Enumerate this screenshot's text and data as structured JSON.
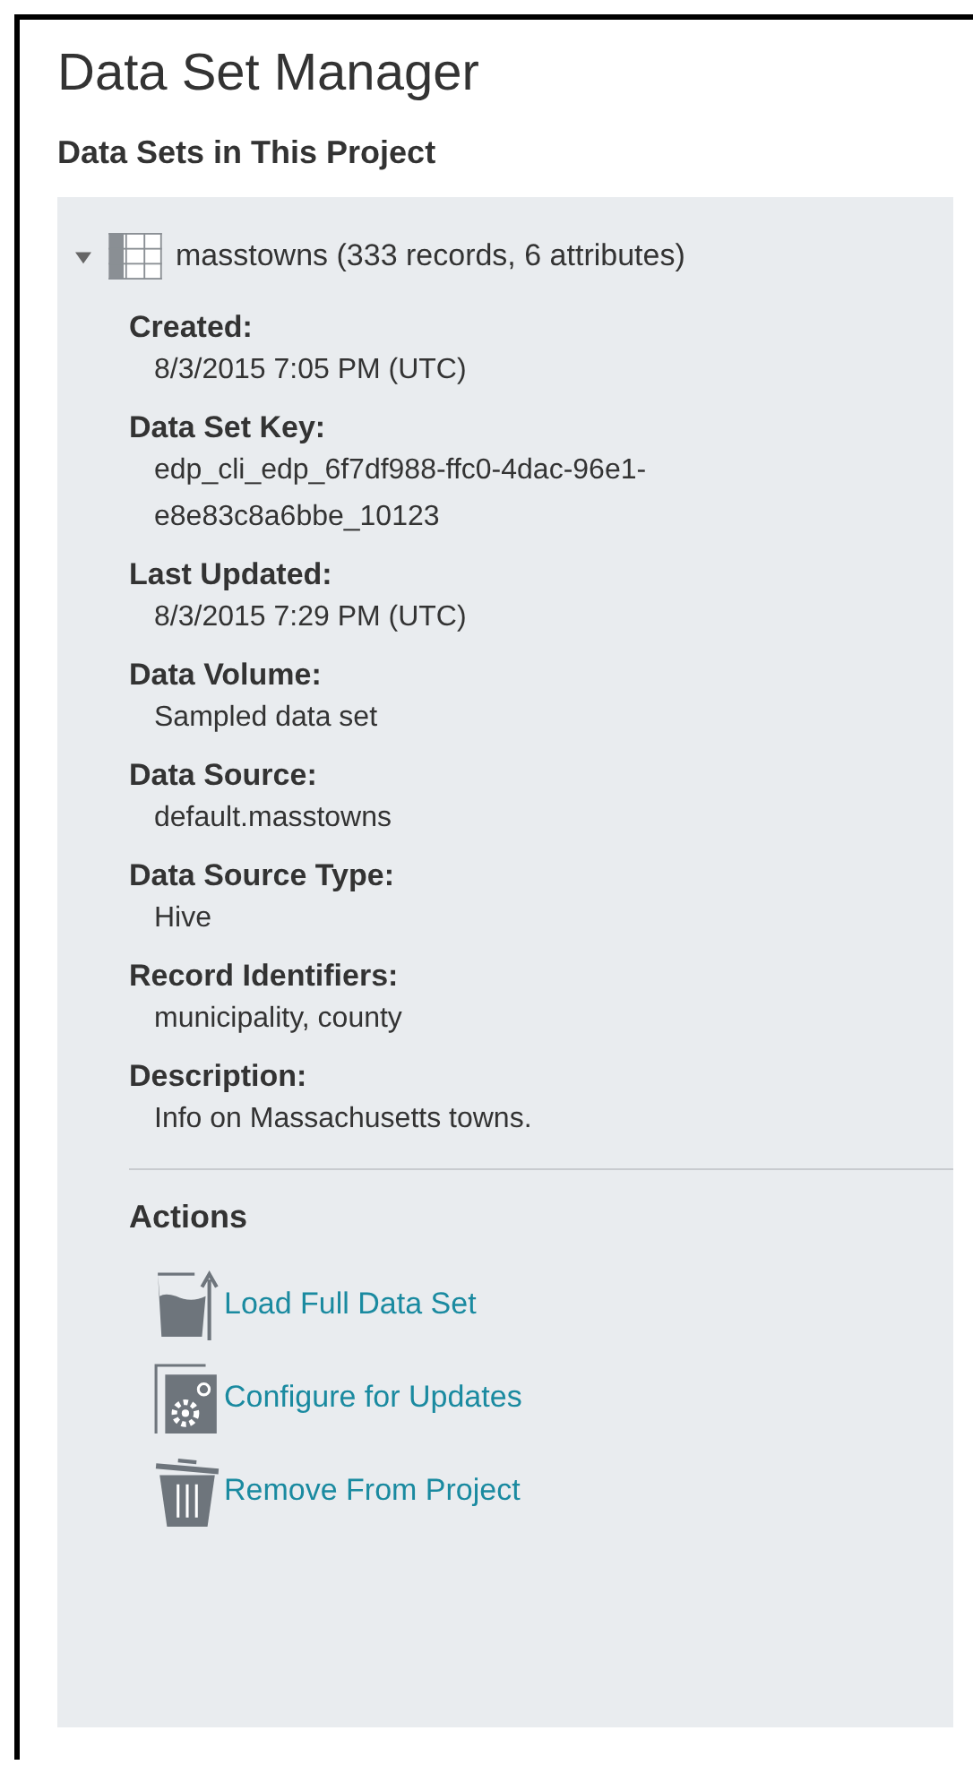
{
  "title": "Data Set Manager",
  "section_title": "Data Sets in This Project",
  "data_set": {
    "name": "masstowns (333 records, 6 attributes)",
    "expanded": true,
    "properties": [
      {
        "label": "Created:",
        "value": "8/3/2015 7:05 PM (UTC)"
      },
      {
        "label": "Data Set Key:",
        "value": "edp_cli_edp_6f7df988-ffc0-4dac-96e1-e8e83c8a6bbe_10123"
      },
      {
        "label": "Last Updated:",
        "value": "8/3/2015 7:29 PM (UTC)"
      },
      {
        "label": "Data Volume:",
        "value": "Sampled data set"
      },
      {
        "label": "Data Source:",
        "value": "default.masstowns"
      },
      {
        "label": "Data Source Type:",
        "value": "Hive"
      },
      {
        "label": "Record Identifiers:",
        "value": "municipality, county"
      },
      {
        "label": "Description:",
        "value": "Info on Massachusetts towns."
      }
    ],
    "actions_title": "Actions",
    "actions": [
      {
        "kind": "load",
        "label": "Load Full Data Set"
      },
      {
        "kind": "configure",
        "label": "Configure for Updates"
      },
      {
        "kind": "remove",
        "label": "Remove From Project"
      }
    ]
  }
}
